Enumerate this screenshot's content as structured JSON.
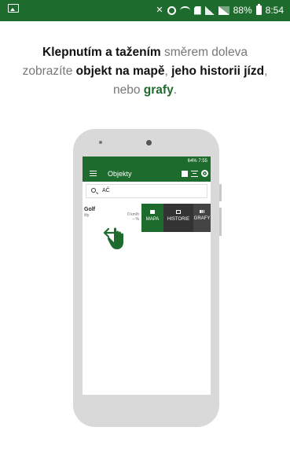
{
  "status_bar": {
    "battery": "88%",
    "time": "8:54"
  },
  "instruction": {
    "part1_bold": "Klepnutím a tažením",
    "part2": " směrem doleva zobrazíte ",
    "part3_bold": "objekt na mapě",
    "part4": ", ",
    "part5_bold": "jeho historii jízd",
    "part6": ", nebo ",
    "part7_accent": "grafy",
    "part8": "."
  },
  "phone": {
    "status_bar": {
      "battery": "64%",
      "time": "7:55"
    },
    "app_title": "Objekty",
    "search": {
      "value": "AČ"
    },
    "list_item": {
      "name": "Golf",
      "subtitle": "šty",
      "speed": "0 km/h",
      "speed_sub": "– %"
    },
    "actions": [
      {
        "label": "MAPA"
      },
      {
        "label": "HISTORIE"
      },
      {
        "label": "GRAFY"
      }
    ]
  },
  "colors": {
    "brand_green": "#1e6b2e",
    "dark_action": "#333333",
    "phone_body": "#d9d9d9"
  },
  "icons": {
    "status_left": "image-icon",
    "hand": "swipe-left-hand-icon"
  }
}
